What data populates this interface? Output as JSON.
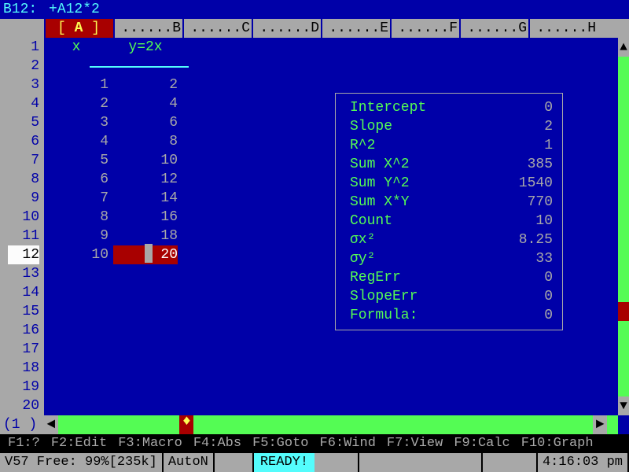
{
  "cell_ref": "B12:",
  "formula": "+A12*2",
  "columns": [
    "A",
    "B",
    "C",
    "D",
    "E",
    "F",
    "G",
    "H"
  ],
  "active_col_index": 0,
  "row_count": 20,
  "active_row": 12,
  "headers": {
    "x": "x",
    "y": "y=2x"
  },
  "data_xy": [
    {
      "x": "1",
      "y": "2"
    },
    {
      "x": "2",
      "y": "4"
    },
    {
      "x": "3",
      "y": "6"
    },
    {
      "x": "4",
      "y": "8"
    },
    {
      "x": "5",
      "y": "10"
    },
    {
      "x": "6",
      "y": "12"
    },
    {
      "x": "7",
      "y": "14"
    },
    {
      "x": "8",
      "y": "16"
    },
    {
      "x": "9",
      "y": "18"
    },
    {
      "x": "10",
      "y": "20"
    }
  ],
  "stats": [
    {
      "label": "Intercept",
      "value": "0"
    },
    {
      "label": "Slope",
      "value": "2"
    },
    {
      "label": "R^2",
      "value": "1"
    },
    {
      "label": "Sum X^2",
      "value": "385"
    },
    {
      "label": "Sum Y^2",
      "value": "1540"
    },
    {
      "label": "Sum X*Y",
      "value": "770"
    },
    {
      "label": "Count",
      "value": "10"
    },
    {
      "label": "σx²",
      "value": "8.25"
    },
    {
      "label": "σy²",
      "value": "33"
    },
    {
      "label": "RegErr",
      "value": "0"
    },
    {
      "label": "SlopeErr",
      "value": "0"
    },
    {
      "label": "Formula:",
      "value": "0"
    }
  ],
  "sheet_tab": "(1 )",
  "fkeys": [
    "F1:?",
    "F2:Edit",
    "F3:Macro",
    "F4:Abs",
    "F5:Goto",
    "F6:Wind",
    "F7:View",
    "F9:Calc",
    "F10:Graph"
  ],
  "status": {
    "left": "V57 Free: 99%[235k]",
    "auton": "AutoN",
    "ready": "READY!",
    "time": "4:16:03 pm"
  }
}
